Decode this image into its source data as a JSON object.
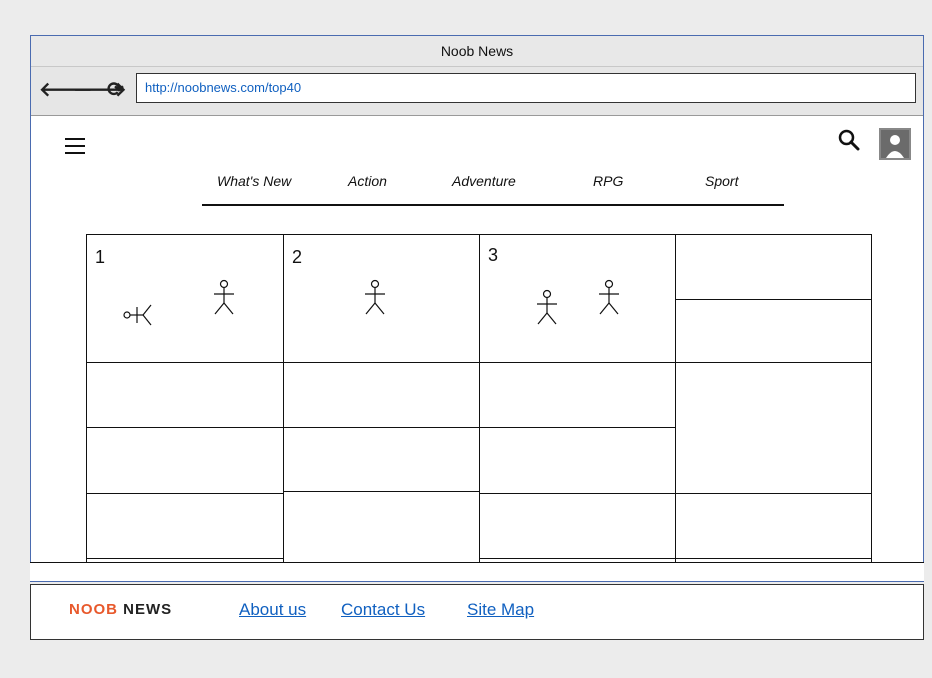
{
  "browser": {
    "title": "Noob News",
    "url": "http://noobnews.com/top40",
    "back_glyph": "🡐",
    "forward_glyph": "🡒",
    "reload_glyph": "⟳"
  },
  "header": {
    "menu_icon": "hamburger-icon",
    "search_icon": "search-icon",
    "user_icon": "avatar-icon"
  },
  "tabs": [
    "What's New",
    "Action",
    "Adventure",
    "RPG",
    "Sport"
  ],
  "grid": {
    "cells": [
      {
        "number": "1"
      },
      {
        "number": "2"
      },
      {
        "number": "3"
      }
    ]
  },
  "footer": {
    "logo_part1": "NOOB",
    "logo_part2": "NEWS",
    "links": [
      "About us",
      "Contact Us",
      "Site Map"
    ],
    "colors": {
      "logo_accent": "#e8592c",
      "logo_dark": "#222222",
      "link": "#1060c0"
    }
  }
}
